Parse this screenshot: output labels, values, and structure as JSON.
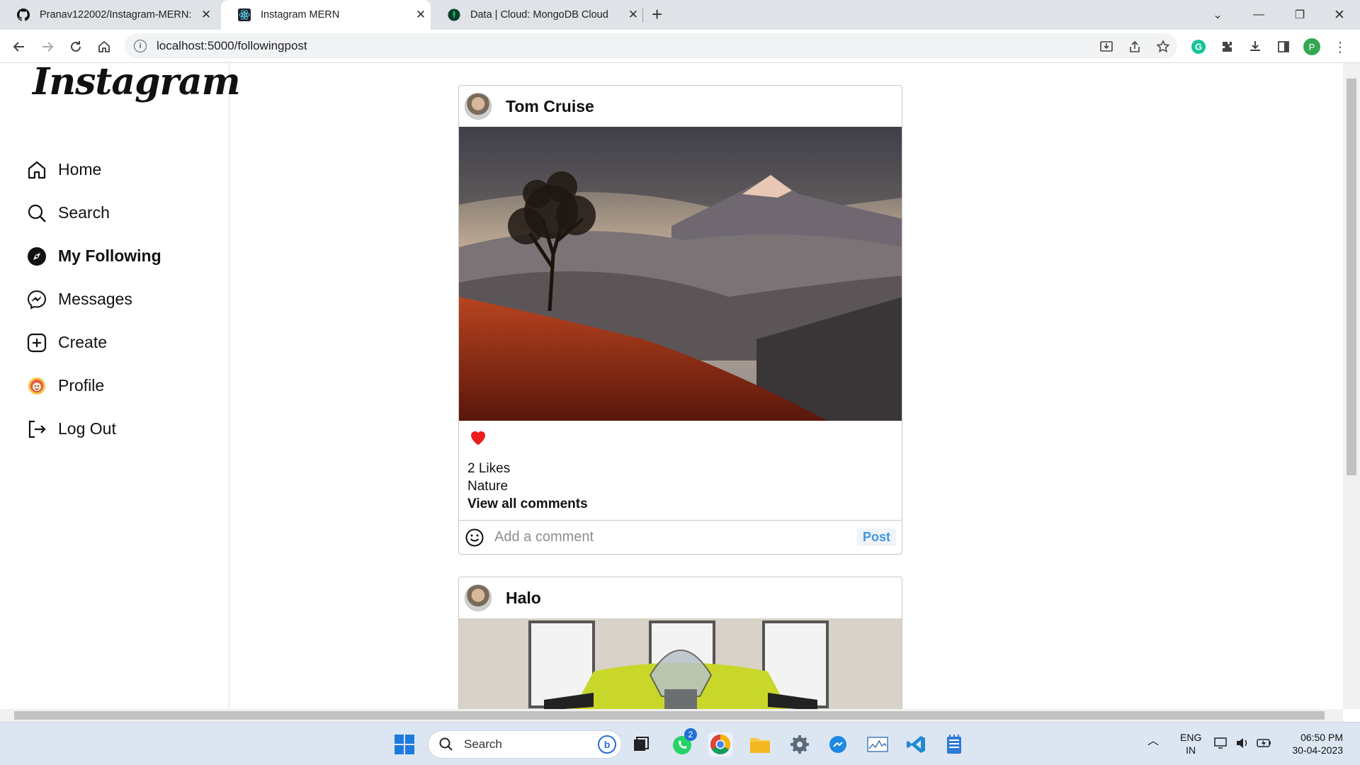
{
  "browser": {
    "tabs": [
      {
        "title": "Pranav122002/Instagram-MERN:",
        "icon": "github-icon",
        "active": false
      },
      {
        "title": "Instagram MERN",
        "icon": "react-icon",
        "active": true
      },
      {
        "title": "Data | Cloud: MongoDB Cloud",
        "icon": "mongodb-leaf-icon",
        "active": false
      }
    ],
    "url": "localhost:5000/followingpost",
    "profile_initial": "P"
  },
  "sidebar": {
    "logo": "Instagram",
    "items": [
      {
        "label": "Home",
        "icon": "home-icon"
      },
      {
        "label": "Search",
        "icon": "search-icon"
      },
      {
        "label": "My Following",
        "icon": "compass-icon",
        "active": true
      },
      {
        "label": "Messages",
        "icon": "messenger-icon"
      },
      {
        "label": "Create",
        "icon": "plus-square-icon"
      },
      {
        "label": "Profile",
        "icon": "avatar-icon"
      },
      {
        "label": "Log Out",
        "icon": "logout-icon"
      }
    ]
  },
  "feed": {
    "posts": [
      {
        "username": "Tom Cruise",
        "likes": "2 Likes",
        "caption": "Nature",
        "view_comments": "View all comments",
        "comment_placeholder": "Add a comment",
        "post_label": "Post",
        "liked": true
      },
      {
        "username": "Halo"
      }
    ]
  },
  "taskbar": {
    "search_label": "Search",
    "whatsapp_badge": "2",
    "language": "ENG",
    "region": "IN",
    "time": "06:50 PM",
    "date": "30-04-2023"
  },
  "colors": {
    "heart": "#ed1c1c",
    "post_button": "#3f96e0",
    "tab_bar": "#dfe3e8",
    "taskbar": "#dce6f3"
  }
}
